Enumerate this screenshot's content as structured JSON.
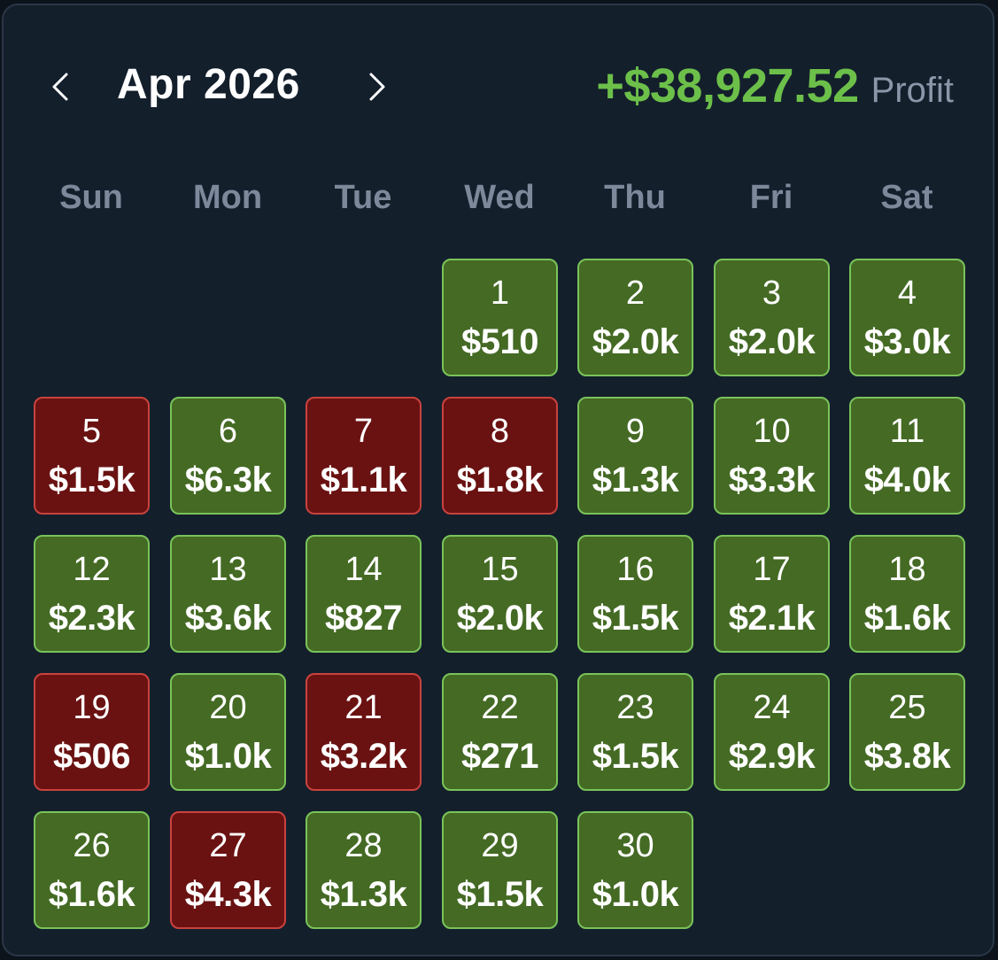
{
  "header": {
    "month_title": "Apr 2026",
    "prev_icon": "chevron-left-icon",
    "next_icon": "chevron-right-icon",
    "profit_value": "+$38,927.52",
    "profit_label": "Profit"
  },
  "colors": {
    "profit_positive": "#6cc04a",
    "gain_cell_bg": "#446a24",
    "gain_cell_border": "#7ac35a",
    "loss_cell_bg": "#6a1212",
    "loss_cell_border": "#c9423e"
  },
  "weekdays": [
    "Sun",
    "Mon",
    "Tue",
    "Wed",
    "Thu",
    "Fri",
    "Sat"
  ],
  "first_weekday_index": 3,
  "days": [
    {
      "day": "1",
      "amount": "$510",
      "status": "gain"
    },
    {
      "day": "2",
      "amount": "$2.0k",
      "status": "gain"
    },
    {
      "day": "3",
      "amount": "$2.0k",
      "status": "gain"
    },
    {
      "day": "4",
      "amount": "$3.0k",
      "status": "gain"
    },
    {
      "day": "5",
      "amount": "$1.5k",
      "status": "loss"
    },
    {
      "day": "6",
      "amount": "$6.3k",
      "status": "gain"
    },
    {
      "day": "7",
      "amount": "$1.1k",
      "status": "loss"
    },
    {
      "day": "8",
      "amount": "$1.8k",
      "status": "loss"
    },
    {
      "day": "9",
      "amount": "$1.3k",
      "status": "gain"
    },
    {
      "day": "10",
      "amount": "$3.3k",
      "status": "gain"
    },
    {
      "day": "11",
      "amount": "$4.0k",
      "status": "gain"
    },
    {
      "day": "12",
      "amount": "$2.3k",
      "status": "gain"
    },
    {
      "day": "13",
      "amount": "$3.6k",
      "status": "gain"
    },
    {
      "day": "14",
      "amount": "$827",
      "status": "gain"
    },
    {
      "day": "15",
      "amount": "$2.0k",
      "status": "gain"
    },
    {
      "day": "16",
      "amount": "$1.5k",
      "status": "gain"
    },
    {
      "day": "17",
      "amount": "$2.1k",
      "status": "gain"
    },
    {
      "day": "18",
      "amount": "$1.6k",
      "status": "gain"
    },
    {
      "day": "19",
      "amount": "$506",
      "status": "loss"
    },
    {
      "day": "20",
      "amount": "$1.0k",
      "status": "gain"
    },
    {
      "day": "21",
      "amount": "$3.2k",
      "status": "loss"
    },
    {
      "day": "22",
      "amount": "$271",
      "status": "gain"
    },
    {
      "day": "23",
      "amount": "$1.5k",
      "status": "gain"
    },
    {
      "day": "24",
      "amount": "$2.9k",
      "status": "gain"
    },
    {
      "day": "25",
      "amount": "$3.8k",
      "status": "gain"
    },
    {
      "day": "26",
      "amount": "$1.6k",
      "status": "gain"
    },
    {
      "day": "27",
      "amount": "$4.3k",
      "status": "loss"
    },
    {
      "day": "28",
      "amount": "$1.3k",
      "status": "gain"
    },
    {
      "day": "29",
      "amount": "$1.5k",
      "status": "gain"
    },
    {
      "day": "30",
      "amount": "$1.0k",
      "status": "gain"
    }
  ]
}
